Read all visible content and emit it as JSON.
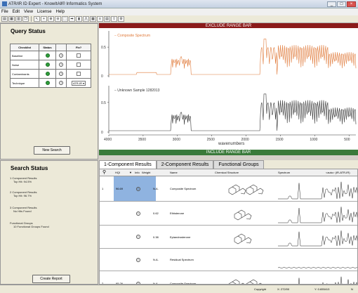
{
  "window": {
    "title": "ATR/IR ID Expert - KnowItAll® Informatics System"
  },
  "menu": [
    "File",
    "Edit",
    "View",
    "License",
    "Help"
  ],
  "left_top": {
    "title": "Query Status",
    "columns": [
      "Checklist",
      "Status",
      "",
      "Fix?"
    ],
    "rows": [
      {
        "name": "Baseline",
        "fix": ""
      },
      {
        "name": "Noise",
        "fix": ""
      },
      {
        "name": "Contaminants",
        "fix": ""
      },
      {
        "name": "Technique",
        "fix": "ATR-IR"
      }
    ],
    "new_search": "New Search"
  },
  "range_bars": {
    "exclude": "EXCLUDE RANGE BAR",
    "include": "INCLUDE RANGE BAR"
  },
  "chart_data": [
    {
      "type": "line",
      "title": "",
      "series": [
        {
          "name": "Composite Spectrum",
          "color": "#e07a3a"
        }
      ],
      "yticks": [
        "0.5",
        "0"
      ],
      "ylim": [
        0,
        1
      ],
      "xlim": [
        4000,
        400
      ]
    },
    {
      "type": "line",
      "title": "",
      "series": [
        {
          "name": "Unknown Sample 1282013",
          "color": "#333333"
        }
      ],
      "yticks": [
        "0.5",
        "0"
      ],
      "ylim": [
        0,
        1
      ],
      "xlim": [
        4000,
        400
      ],
      "xticks": [
        "4000",
        "3500",
        "3000",
        "2500",
        "2000",
        "1500",
        "1000",
        "500"
      ],
      "xlabel": "wavenumbers"
    }
  ],
  "left_bottom": {
    "title": "Search Status",
    "items": [
      {
        "line1": "1 Component Results",
        "line2": "Top Hit: 94.5%"
      },
      {
        "line1": "2 Component Results",
        "line2": "Top Hit: 96.7%"
      },
      {
        "line1": "3 Component Results",
        "line2": "No Hits Found"
      },
      {
        "line1": "Functional Groups",
        "line2": "10 Functional Groups Found"
      }
    ],
    "create_report": "Create Report"
  },
  "tabs": [
    "1-Component Results",
    "2-Component Results",
    "Functional Groups"
  ],
  "results_header": [
    "HQI",
    "Info",
    "Weight",
    "Name",
    "Chemical Structure",
    "Spectrum",
    "<auto> (IR-ATR-IR)"
  ],
  "results": [
    {
      "num": "1",
      "hqi": "96.69",
      "weight": "N.A.",
      "name": "Composite Spectrum"
    },
    {
      "num": "",
      "hqi": "",
      "weight": "0.62",
      "name": "Ethisterone"
    },
    {
      "num": "",
      "hqi": "",
      "weight": "0.38",
      "name": "Epiandrosterone"
    },
    {
      "num": "",
      "hqi": "",
      "weight": "N.A.",
      "name": "Residual Spectrum"
    },
    {
      "num": "2",
      "hqi": "95.26",
      "weight": "N.A.",
      "name": "Composite Spectrum"
    }
  ],
  "statusbar": {
    "copyright": "Copyright",
    "x": "X: 272/00",
    "y": "Y: 0.655413",
    "tail": "N"
  }
}
